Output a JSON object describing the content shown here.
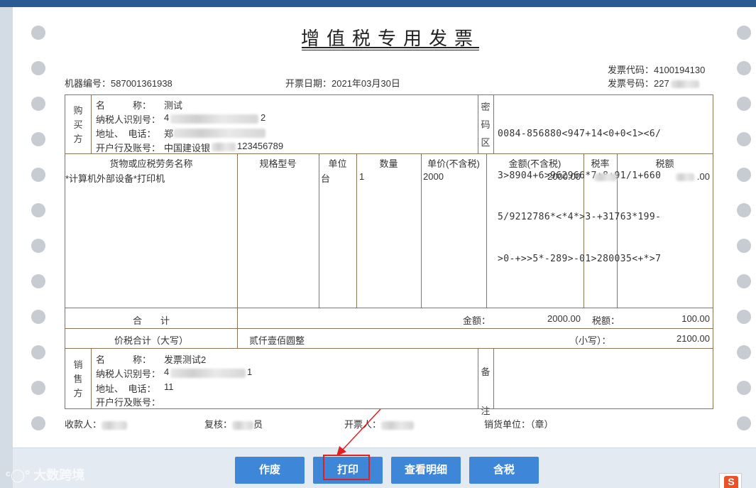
{
  "invoice": {
    "title": "增值税专用发票",
    "code_label": "发票代码：",
    "code_value": "4100194130",
    "number_label": "发票号码：",
    "number_value": "227",
    "machine_label": "机器编号：",
    "machine_value": "587001361938",
    "date_label": "开票日期：",
    "date_value": "2021年03月30日"
  },
  "buyer": {
    "section_label": [
      "购",
      "买",
      "方"
    ],
    "name_label": "名　　　称：",
    "name_value": "测试",
    "tax_id_label": "纳税人识别号：",
    "tax_id_value": "4",
    "tax_id_tail": "2",
    "address_label": "地址、　电话：",
    "address_value": "郑",
    "bank_label": "开户行及账号：",
    "bank_value": "中国建设银",
    "bank_tail": "123456789"
  },
  "password": {
    "section_label": [
      "密",
      "码",
      "区"
    ],
    "lines": [
      "0084-856880<947+14<0+0<1><6/",
      "3>8904+6>962966*7+8+91/1+660",
      "5/9212786*<*4*>3-+31763*199-",
      ">0-+>>5*-289>-01>280035<+*>7"
    ]
  },
  "table": {
    "headers": [
      "货物或应税劳务名称",
      "规格型号",
      "单位",
      "数量",
      "单价(不含税)",
      "金额(不含税)",
      "税率",
      "税额"
    ],
    "rows": [
      {
        "name": "*计算机外部设备*打印机",
        "spec": "",
        "unit": "台",
        "qty": "1",
        "price": "2000",
        "amount": "2000.00",
        "rate": "",
        "tax": ".00"
      }
    ]
  },
  "totals": {
    "label": "合　　计",
    "amount_label": "金额：",
    "amount_value": "2000.00",
    "tax_label": "税额：",
    "tax_value": "100.00",
    "total_label": "价税合计（大写）",
    "total_words": "贰仟壹佰圆整",
    "small_label": "（小写）：",
    "small_value": "2100.00"
  },
  "seller": {
    "section_label": [
      "销",
      "售",
      "方"
    ],
    "name_label": "名　　　称：",
    "name_value": "发票测试2",
    "tax_id_label": "纳税人识别号：",
    "tax_id_value": "4",
    "tax_id_tail": "1",
    "address_label": "地址、　电话：",
    "address_value": "11",
    "bank_label": "开户行及账号：",
    "bank_value": ""
  },
  "remarks": {
    "section_label": [
      "备",
      "注"
    ]
  },
  "signatures": {
    "payee_label": "收款人：",
    "reviewer_label": "复核：",
    "reviewer_tail": "员",
    "drawer_label": "开票人：",
    "seller_unit_label": "销货单位：（章）"
  },
  "buttons": {
    "void_label": "作废",
    "print_label": "打印",
    "detail_label": "查看明细",
    "tax_incl_label": "含税"
  },
  "watermark": "大数跨境",
  "colors": {
    "top_bar": "#2a5b93",
    "button": "#3d86d8",
    "table_border": "#8b7355",
    "highlight": "#e02020"
  }
}
